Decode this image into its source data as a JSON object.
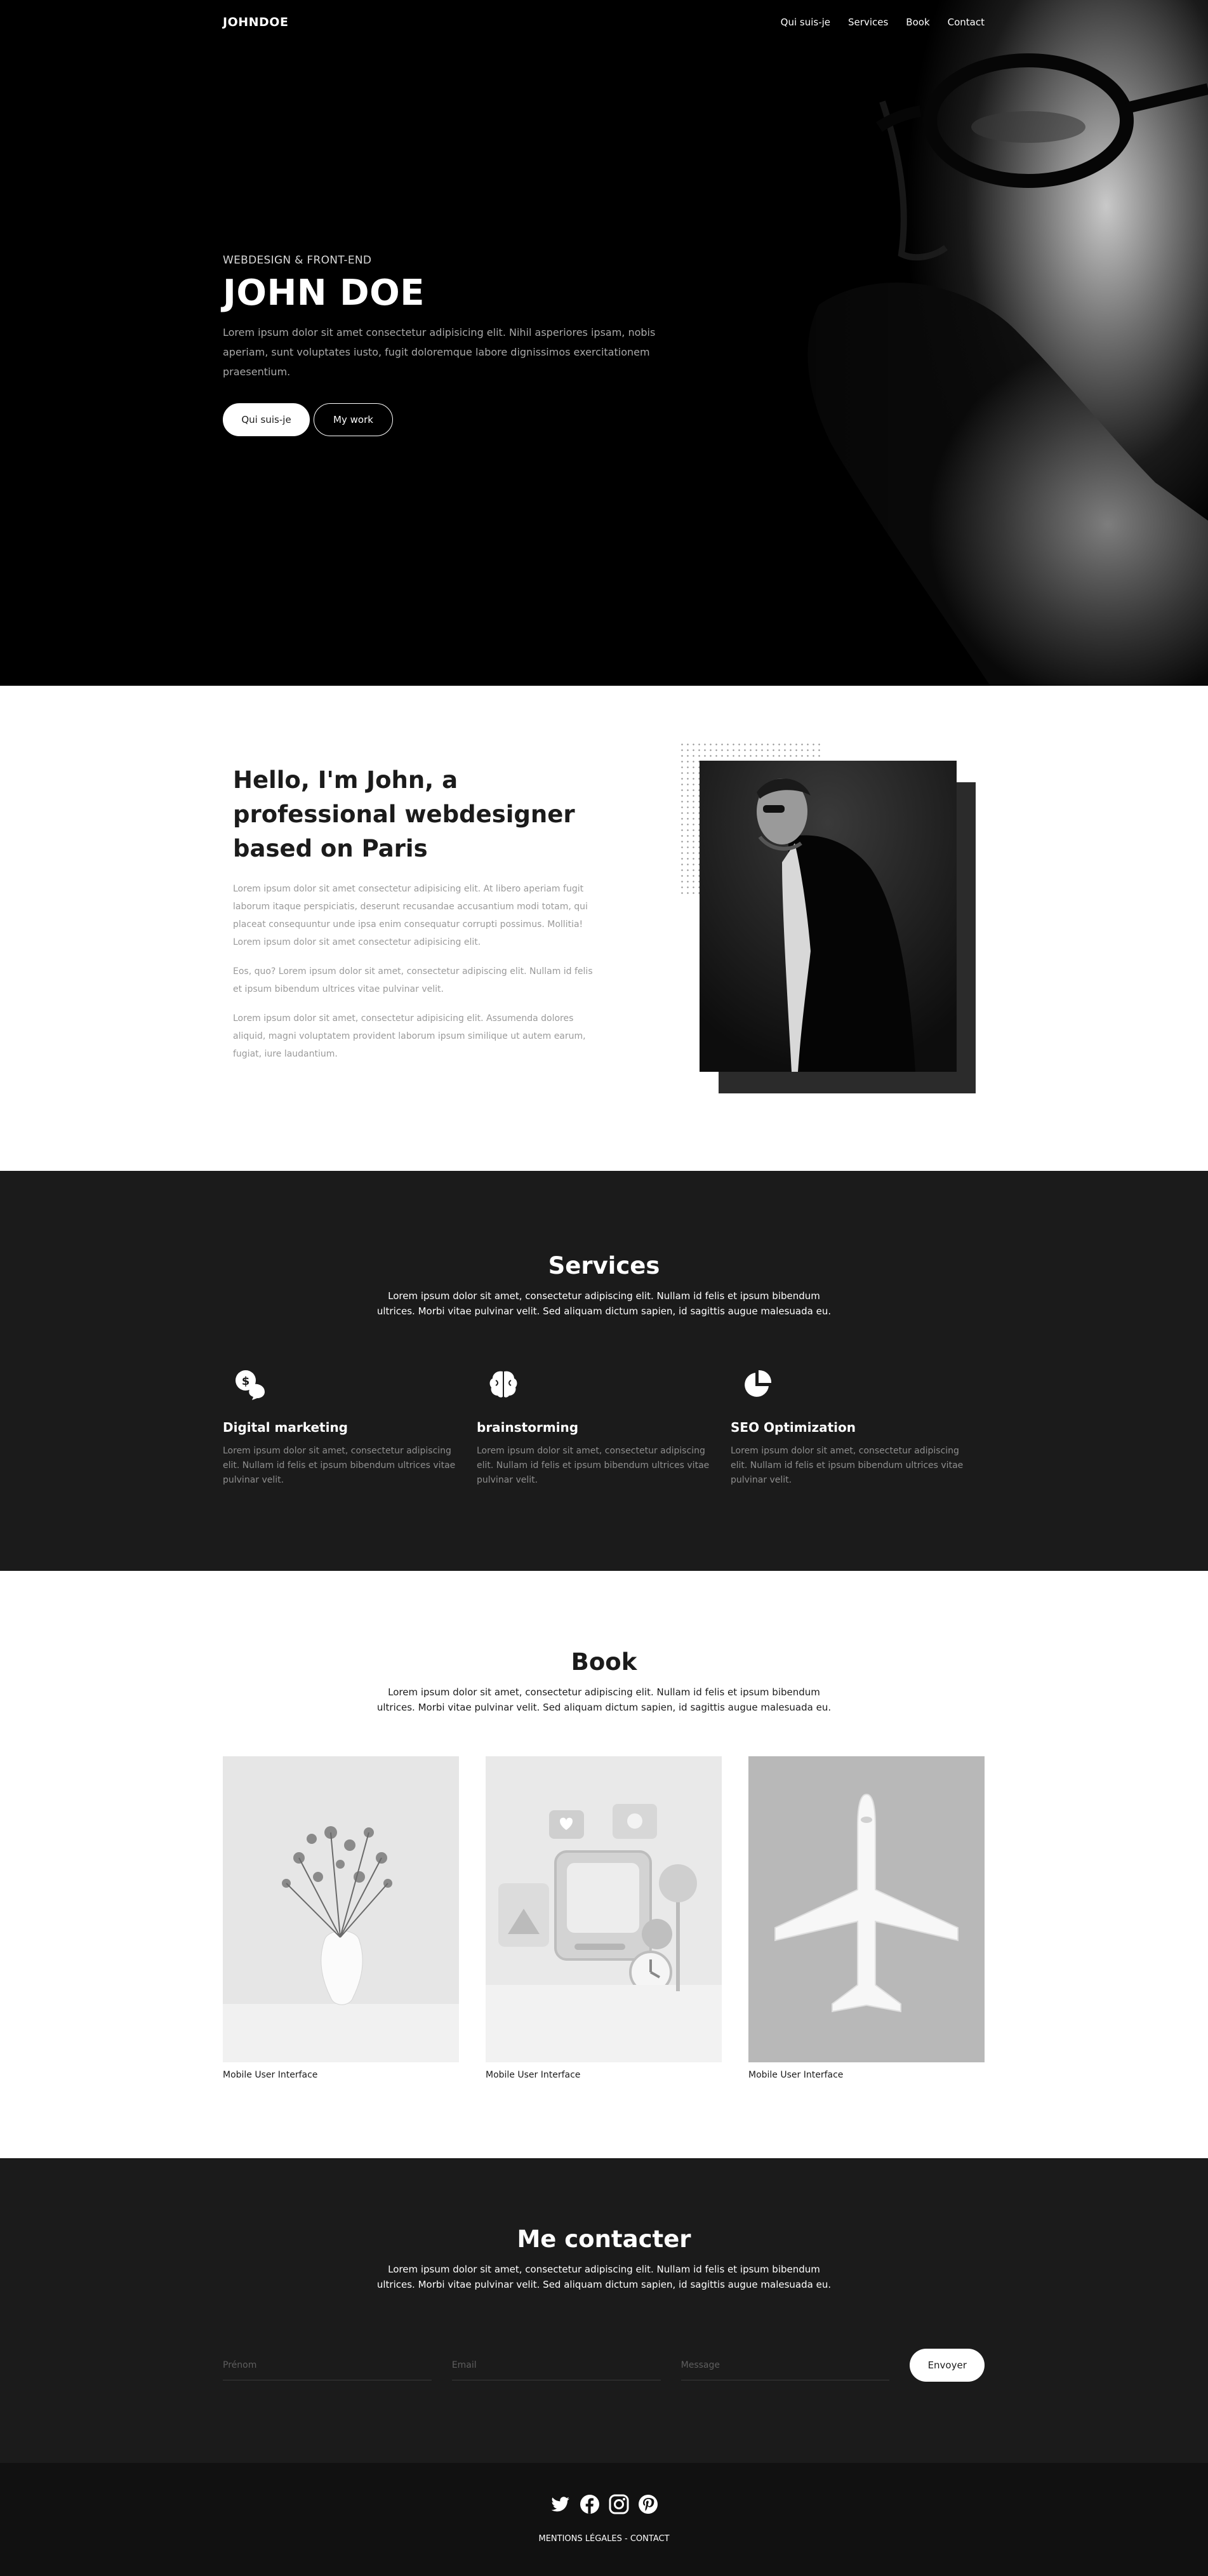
{
  "nav": {
    "logo": "JOHNDOE",
    "items": [
      {
        "label": "Qui suis-je"
      },
      {
        "label": "Services"
      },
      {
        "label": "Book"
      },
      {
        "label": "Contact"
      }
    ]
  },
  "hero": {
    "subtitle": "WEBDESIGN & FRONT-END",
    "title": "JOHN DOE",
    "text": "Lorem ipsum dolor sit amet consectetur adipisicing elit. Nihil asperiores ipsam, nobis aperiam, sunt voluptates iusto, fugit doloremque labore dignissimos exercitationem praesentium.",
    "btn_primary": "Qui suis-je",
    "btn_secondary": "My work"
  },
  "about": {
    "title": "Hello, I'm John, a professional webdesigner based on Paris",
    "paragraphs": [
      "Lorem ipsum dolor sit amet consectetur adipisicing elit. At libero aperiam fugit laborum itaque perspiciatis, deserunt recusandae accusantium modi totam, qui placeat consequuntur unde ipsa enim consequatur corrupti possimus. Mollitia! Lorem ipsum dolor sit amet consectetur adipisicing elit.",
      "Eos, quo? Lorem ipsum dolor sit amet, consectetur adipiscing elit. Nullam id felis et ipsum bibendum ultrices vitae pulvinar velit.",
      "Lorem ipsum dolor sit amet, consectetur adipisicing elit. Assumenda dolores aliquid, magni voluptatem provident laborum ipsum similique ut autem earum, fugiat, iure laudantium."
    ]
  },
  "services": {
    "title": "Services",
    "subtitle": "Lorem ipsum dolor sit amet, consectetur adipiscing elit. Nullam id felis et ipsum bibendum ultrices. Morbi vitae pulvinar velit. Sed aliquam dictum sapien, id sagittis augue malesuada eu.",
    "items": [
      {
        "icon": "dollar-chat-icon",
        "title": "Digital marketing",
        "text": "Lorem ipsum dolor sit amet, consectetur adipiscing elit. Nullam id felis et ipsum bibendum ultrices vitae pulvinar velit."
      },
      {
        "icon": "brain-icon",
        "title": "brainstorming",
        "text": "Lorem ipsum dolor sit amet, consectetur adipiscing elit. Nullam id felis et ipsum bibendum ultrices vitae pulvinar velit."
      },
      {
        "icon": "pie-chart-icon",
        "title": "SEO Optimization",
        "text": "Lorem ipsum dolor sit amet, consectetur adipiscing elit. Nullam id felis et ipsum bibendum ultrices vitae pulvinar velit."
      }
    ]
  },
  "book": {
    "title": "Book",
    "subtitle": "Lorem ipsum dolor sit amet, consectetur adipiscing elit. Nullam id felis et ipsum bibendum ultrices. Morbi vitae pulvinar velit. Sed aliquam dictum sapien, id sagittis augue malesuada eu.",
    "items": [
      {
        "caption": "Mobile User Interface"
      },
      {
        "caption": "Mobile User Interface"
      },
      {
        "caption": "Mobile User Interface"
      }
    ]
  },
  "contact": {
    "title": "Me contacter",
    "subtitle": "Lorem ipsum dolor sit amet, consectetur adipiscing elit. Nullam id felis et ipsum bibendum ultrices. Morbi vitae pulvinar velit. Sed aliquam dictum sapien, id sagittis augue malesuada eu.",
    "firstname_placeholder": "Prénom",
    "email_placeholder": "Email",
    "message_placeholder": "Message",
    "send_label": "Envoyer"
  },
  "footer": {
    "socials": [
      "twitter-icon",
      "facebook-icon",
      "instagram-icon",
      "pinterest-icon"
    ],
    "legal": "MENTIONS LÉGALES",
    "separator": " - ",
    "contact": "CONTACT"
  },
  "colors": {
    "dark": "#1b1b1b",
    "footer": "#111111",
    "muted_text": "#9a9a9a",
    "white": "#ffffff"
  }
}
